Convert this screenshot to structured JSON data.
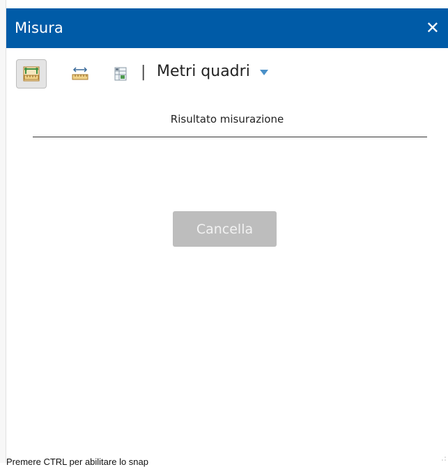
{
  "header": {
    "title": "Misura",
    "close_icon": "close-icon"
  },
  "toolbar": {
    "tools": [
      {
        "name": "area-measure-icon",
        "active": true
      },
      {
        "name": "distance-measure-icon",
        "active": false
      },
      {
        "name": "location-measure-icon",
        "active": false
      }
    ],
    "separator": "|",
    "unit_label": "Metri quadri",
    "unit_dropdown_icon": "caret-down-icon"
  },
  "result": {
    "label": "Risultato misurazione"
  },
  "actions": {
    "clear_label": "Cancella"
  },
  "footer": {
    "hint": "Premere CTRL per abilitare lo snap"
  },
  "colors": {
    "header_bg": "#005ba7",
    "accent": "#4a90c8",
    "button_disabled": "#bdbdbd"
  }
}
